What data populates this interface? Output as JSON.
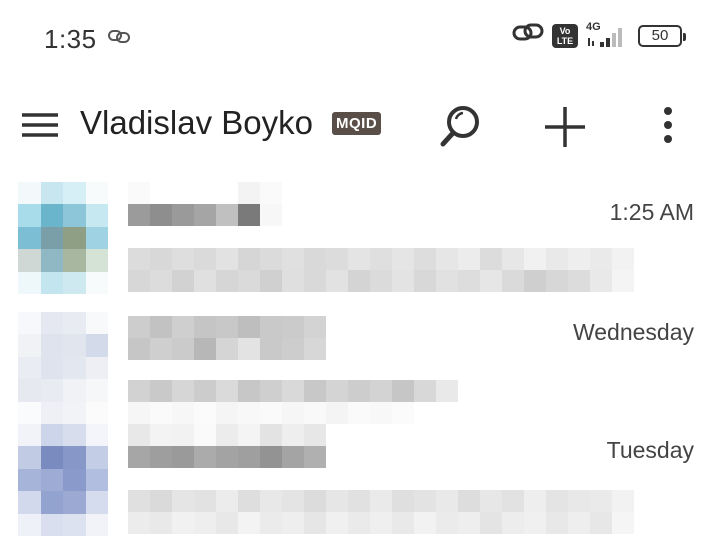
{
  "status_bar": {
    "time": "1:35",
    "volte": "Vo\nLTE",
    "network": "4G",
    "battery": "50"
  },
  "app_bar": {
    "title": "Vladislav Boyko",
    "badge": "MQID",
    "icons": [
      "menu-icon",
      "search-icon",
      "plus-icon",
      "more-vert-icon"
    ]
  },
  "conversations": [
    {
      "date": "1:25 AM",
      "avatar_colors": [
        "#f3f8fa",
        "#c8e6ef",
        "#d6eef5",
        "#f7fbfc",
        "#a9dceb",
        "#6bb5cc",
        "#8ec6d9",
        "#c5e8f1",
        "#7cbfd5",
        "#7a9fa9",
        "#8e9f85",
        "#9fd2e2",
        "#cfd8d4",
        "#8fb8c4",
        "#a8b8a0",
        "#d4e3d6",
        "#eef7fa",
        "#c3e5ef",
        "#cfe9f1",
        "#f7fbfc"
      ]
    },
    {
      "date": "Wednesday",
      "avatar_colors": [
        "#f7f8fb",
        "#e5e8f1",
        "#e8ebf2",
        "#f8f9fb",
        "#f1f2f6",
        "#dfe3ee",
        "#e1e5ee",
        "#d3dae9",
        "#e9ecf3",
        "#dfe3ed",
        "#e3e7ef",
        "#edeff4",
        "#e6e9f0",
        "#e8ebf1",
        "#f0f2f6",
        "#f6f7f9",
        "#fafbfc",
        "#eef0f5",
        "#f2f3f7",
        "#fbfbfc"
      ]
    },
    {
      "date": "Tuesday",
      "avatar_colors": [
        "#f1f3f9",
        "#cdd5ea",
        "#d7dded",
        "#f3f5fa",
        "#c2cbe4",
        "#7a8bc0",
        "#8797c8",
        "#c4cde6",
        "#a7b4d9",
        "#9eacd5",
        "#8a9acb",
        "#b2bee0",
        "#d2d9ed",
        "#93a3d0",
        "#9caad3",
        "#d5dcee",
        "#eef1f8",
        "#d9dfef",
        "#dde2f1",
        "#f1f3f9"
      ]
    }
  ]
}
